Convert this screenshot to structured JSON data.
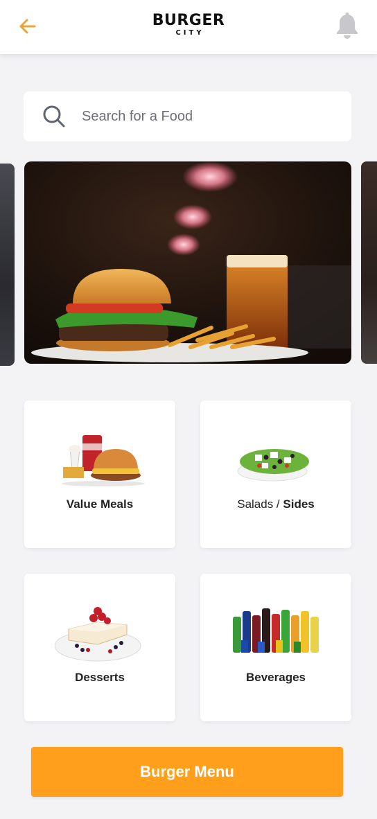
{
  "header": {
    "logo_main": "BURGER",
    "logo_sub": "CITY",
    "back_icon": "arrow-left-icon",
    "notification_icon": "bell-icon"
  },
  "search": {
    "placeholder": "Search for a Food",
    "value": "",
    "icon": "search-icon"
  },
  "categories": [
    {
      "label_part1": "Value Meals",
      "label_part2": ""
    },
    {
      "label_part1": "Salads / ",
      "label_part2": "Sides"
    },
    {
      "label_part1": "Desserts",
      "label_part2": ""
    },
    {
      "label_part1": "Beverages",
      "label_part2": ""
    }
  ],
  "cta": {
    "label": "Burger Menu"
  },
  "colors": {
    "accent": "#ff9f1c",
    "back_arrow": "#e8a63a",
    "bell": "#c8c8cc",
    "background": "#f3f3f6"
  }
}
